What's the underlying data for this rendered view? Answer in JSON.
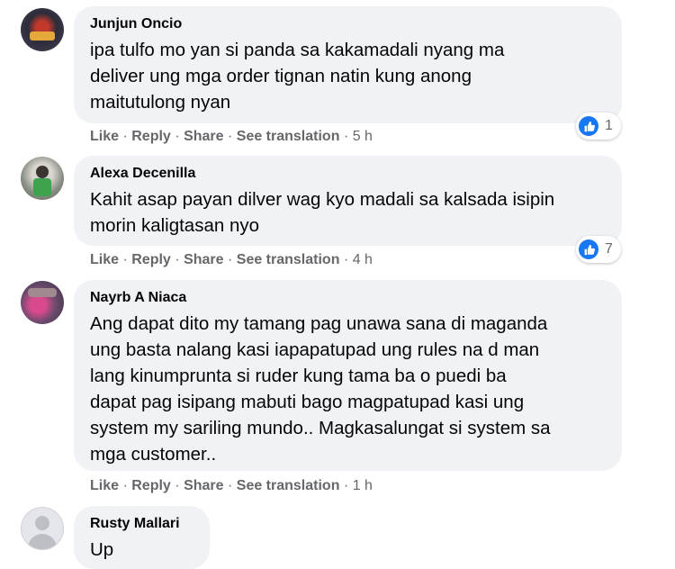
{
  "actions": {
    "like": "Like",
    "reply": "Reply",
    "share": "Share",
    "see_translation": "See translation",
    "separator": "·"
  },
  "comments": [
    {
      "author": "Junjun Oncio",
      "lines": [
        "ipa tulfo mo yan si panda sa kakamadali nyang ma",
        "deliver ung mga order tignan natin kung anong",
        "maitutulong nyan"
      ],
      "time": "5 h",
      "reactions": "1",
      "reaction_icon": "like-icon"
    },
    {
      "author": "Alexa Decenilla",
      "lines": [
        "Kahit asap payan dilver wag kyo madali sa kalsada isipin",
        "morin kaligtasan nyo"
      ],
      "time": "4 h",
      "reactions": "7",
      "reaction_icon": "like-icon"
    },
    {
      "author": "Nayrb A Niaca",
      "lines": [
        "Ang dapat dito my tamang pag unawa sana di maganda",
        "ung basta nalang kasi iapapatupad ung rules na d man",
        "lang kinumprunta si ruder kung tama ba o puedi ba",
        "dapat pag isipang mabuti bago magpatupad kasi ung",
        "system my sariling mundo.. Magkasalungat si system sa",
        "mga customer.."
      ],
      "time": "1 h"
    },
    {
      "author": "Rusty Mallari",
      "lines": [
        "Up"
      ]
    }
  ],
  "colors": {
    "bubble": "#f0f2f5",
    "meta_text": "#65676b",
    "like_blue": "#1877f2"
  }
}
